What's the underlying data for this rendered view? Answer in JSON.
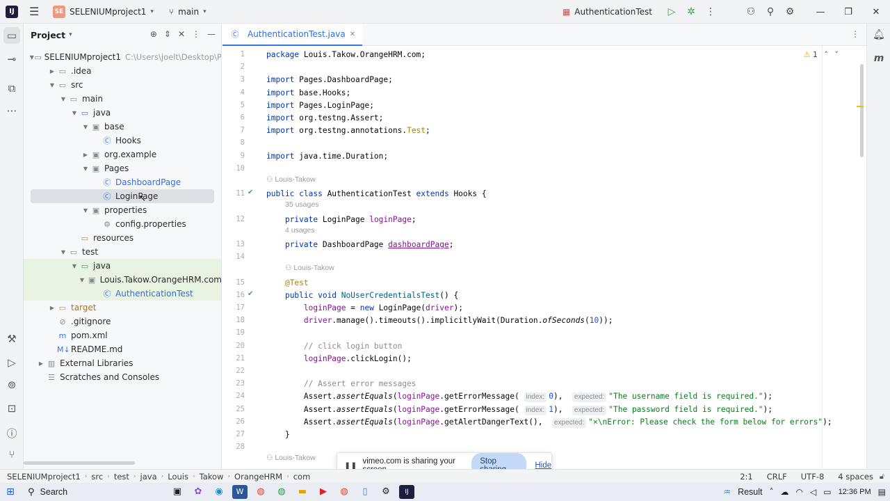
{
  "titlebar": {
    "app_icon": "intellij-icon",
    "project_badge": "SE",
    "project_name": "SELENIUMproject1",
    "branch": "main",
    "run_config": "AuthenticationTest"
  },
  "project_panel": {
    "title": "Project",
    "tree": [
      {
        "label": "SELENIUMproject1",
        "path": "C:\\Users\\joelt\\Desktop\\P",
        "level": 0,
        "arrow": "open",
        "icon": "folder",
        "style": ""
      },
      {
        "label": ".idea",
        "level": 1,
        "arrow": "closed",
        "icon": "folder",
        "style": ""
      },
      {
        "label": "src",
        "level": 1,
        "arrow": "open",
        "icon": "folder",
        "style": ""
      },
      {
        "label": "main",
        "level": 2,
        "arrow": "open",
        "icon": "folder",
        "style": ""
      },
      {
        "label": "java",
        "level": 3,
        "arrow": "open",
        "icon": "folder-src",
        "style": ""
      },
      {
        "label": "base",
        "level": 4,
        "arrow": "open",
        "icon": "package",
        "style": ""
      },
      {
        "label": "Hooks",
        "level": 5,
        "arrow": "",
        "icon": "class",
        "style": ""
      },
      {
        "label": "org.example",
        "level": 4,
        "arrow": "closed",
        "icon": "package",
        "style": ""
      },
      {
        "label": "Pages",
        "level": 4,
        "arrow": "open",
        "icon": "package",
        "style": ""
      },
      {
        "label": "DashboardPage",
        "level": 5,
        "arrow": "",
        "icon": "class",
        "style": "blue"
      },
      {
        "label": "LoginPage",
        "level": 5,
        "arrow": "",
        "icon": "class",
        "style": "",
        "selected": true
      },
      {
        "label": "properties",
        "level": 4,
        "arrow": "open",
        "icon": "package",
        "style": ""
      },
      {
        "label": "config.properties",
        "level": 5,
        "arrow": "",
        "icon": "gear",
        "style": ""
      },
      {
        "label": "resources",
        "level": 3,
        "arrow": "",
        "icon": "folder-res",
        "style": ""
      },
      {
        "label": "test",
        "level": 2,
        "arrow": "open",
        "icon": "folder",
        "style": ""
      },
      {
        "label": "java",
        "level": 3,
        "arrow": "open",
        "icon": "folder-test",
        "style": "",
        "green": true
      },
      {
        "label": "Louis.Takow.OrangeHRM.com",
        "level": 4,
        "arrow": "open",
        "icon": "package",
        "style": "",
        "green": true
      },
      {
        "label": "AuthenticationTest",
        "level": 5,
        "arrow": "",
        "icon": "class",
        "style": "blue",
        "green": true
      },
      {
        "label": "target",
        "level": 1,
        "arrow": "closed",
        "icon": "folder-orange",
        "style": "orange"
      },
      {
        "label": ".gitignore",
        "level": 1,
        "arrow": "",
        "icon": "ignore",
        "style": ""
      },
      {
        "label": "pom.xml",
        "level": 1,
        "arrow": "",
        "icon": "maven",
        "style": ""
      },
      {
        "label": "README.md",
        "level": 1,
        "arrow": "",
        "icon": "markdown",
        "style": ""
      },
      {
        "label": "External Libraries",
        "level": 0,
        "arrow": "closed",
        "icon": "library",
        "style": ""
      },
      {
        "label": "Scratches and Consoles",
        "level": 0,
        "arrow": "",
        "icon": "scratch",
        "style": ""
      }
    ]
  },
  "editor": {
    "tab_label": "AuthenticationTest.java",
    "warning_count": "1",
    "lines": [
      {
        "n": "1",
        "html": "<span class='kw'>package</span> Louis.Takow.OrangeHRM.com;"
      },
      {
        "n": "2",
        "html": ""
      },
      {
        "n": "3",
        "html": "<span class='kw'>import</span> Pages.DashboardPage;"
      },
      {
        "n": "4",
        "html": "<span class='kw'>import</span> base.Hooks;"
      },
      {
        "n": "5",
        "html": "<span class='kw'>import</span> Pages.LoginPage;"
      },
      {
        "n": "6",
        "html": "<span class='kw'>import</span> org.testng.Assert;"
      },
      {
        "n": "7",
        "html": "<span class='kw'>import</span> org.testng.annotations.<span class='ann'>Test</span>;"
      },
      {
        "n": "8",
        "html": ""
      },
      {
        "n": "9",
        "html": "<span class='kw'>import</span> java.time.Duration;"
      },
      {
        "n": "10",
        "html": ""
      },
      {
        "n": "11",
        "html": "<span class='kw'>public class</span> AuthenticationTest <span class='kw'>extends</span> Hooks {",
        "hint": "Louis-Takow",
        "run": true
      },
      {
        "n": "12",
        "html": "    <span class='kw'>private</span> LoginPage <span class='fld'>loginPage</span>;",
        "hint": "35 usages"
      },
      {
        "n": "13",
        "html": "    <span class='kw'>private</span> DashboardPage <span class='fld' style='text-decoration: underline;'>dashboardPage</span>;",
        "hint": "4 usages"
      },
      {
        "n": "14",
        "html": ""
      },
      {
        "n": "15",
        "html": "    <span class='ann'>@Test</span>",
        "hint": "Louis-Takow"
      },
      {
        "n": "16",
        "html": "    <span class='kw'>public void</span> <span class='fn'>NoUserCredentialsTest</span>() {",
        "run": true
      },
      {
        "n": "17",
        "html": "        <span class='fld'>loginPage</span> = <span class='kw'>new</span> LoginPage(<span class='fld'>driver</span>);"
      },
      {
        "n": "18",
        "html": "        <span class='fld'>driver</span>.manage().timeouts().implicitlyWait(Duration.<span class='ital'>ofSeconds</span>(<span class='num'>10</span>));"
      },
      {
        "n": "19",
        "html": ""
      },
      {
        "n": "20",
        "html": "        <span class='cmt'>// click login button</span>"
      },
      {
        "n": "21",
        "html": "        <span class='fld'>loginPage</span>.clickLogin();"
      },
      {
        "n": "22",
        "html": ""
      },
      {
        "n": "23",
        "html": "        <span class='cmt'>// Assert error messages</span>"
      },
      {
        "n": "24",
        "html": "        Assert.<span class='ital'>assertEquals</span>(<span class='fld'>loginPage</span>.getErrorMessage( <span class='inlay'>index:</span><span class='num'>0</span>),  <span class='inlay'>expected:</span><span class='str'>\"The username field is required.\"</span>);"
      },
      {
        "n": "25",
        "html": "        Assert.<span class='ital'>assertEquals</span>(<span class='fld'>loginPage</span>.getErrorMessage( <span class='inlay'>index:</span><span class='num'>1</span>),  <span class='inlay'>expected:</span><span class='str'>\"The password field is required.\"</span>);"
      },
      {
        "n": "26",
        "html": "        Assert.<span class='ital'>assertEquals</span>(<span class='fld'>loginPage</span>.getAlertDangerText(),  <span class='inlay'>expected:</span><span class='str'>\"×\\nError: Please check the form below for errors\"</span>);"
      },
      {
        "n": "27",
        "html": "    }"
      },
      {
        "n": "28",
        "html": ""
      },
      {
        "n": "",
        "html": "",
        "hint": "Louis-Takow"
      }
    ]
  },
  "share_popup": {
    "text": "vimeo.com is sharing your screen.",
    "stop_label": "Stop sharing",
    "hide_label": "Hide"
  },
  "statusbar": {
    "breadcrumb": [
      "SELENIUMproject1",
      "src",
      "test",
      "java",
      "Louis",
      "Takow",
      "OrangeHRM",
      "com"
    ],
    "position": "2:1",
    "line_ending": "CRLF",
    "encoding": "UTF-8",
    "indent": "4 spaces"
  },
  "taskbar": {
    "search_label": "Search",
    "result_label": "Result",
    "time": "12:36 PM"
  }
}
